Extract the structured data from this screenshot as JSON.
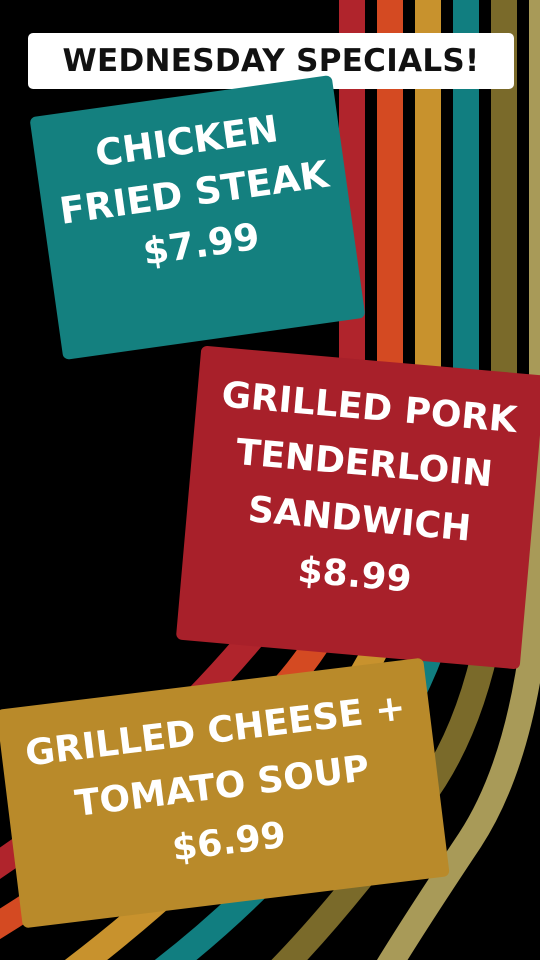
{
  "colors": {
    "background": "#000000",
    "stripes": [
      "#b0242c",
      "#d44a22",
      "#c8922d",
      "#117e80",
      "#7a6a2a",
      "#a89a58"
    ],
    "card1_bg": "#14807f",
    "card2_bg": "#a8202a",
    "card3_bg": "#b98a2a",
    "title_bg": "#ffffff",
    "title_text": "#111111"
  },
  "header": {
    "title": "WEDNESDAY SPECIALS!"
  },
  "specials": [
    {
      "lines": [
        "CHICKEN",
        "FRIED STEAK"
      ],
      "price": "$7.99"
    },
    {
      "lines": [
        "GRILLED PORK",
        "TENDERLOIN",
        "SANDWICH"
      ],
      "price": "$8.99"
    },
    {
      "lines": [
        "GRILLED CHEESE +",
        "TOMATO SOUP"
      ],
      "price": "$6.99"
    }
  ]
}
